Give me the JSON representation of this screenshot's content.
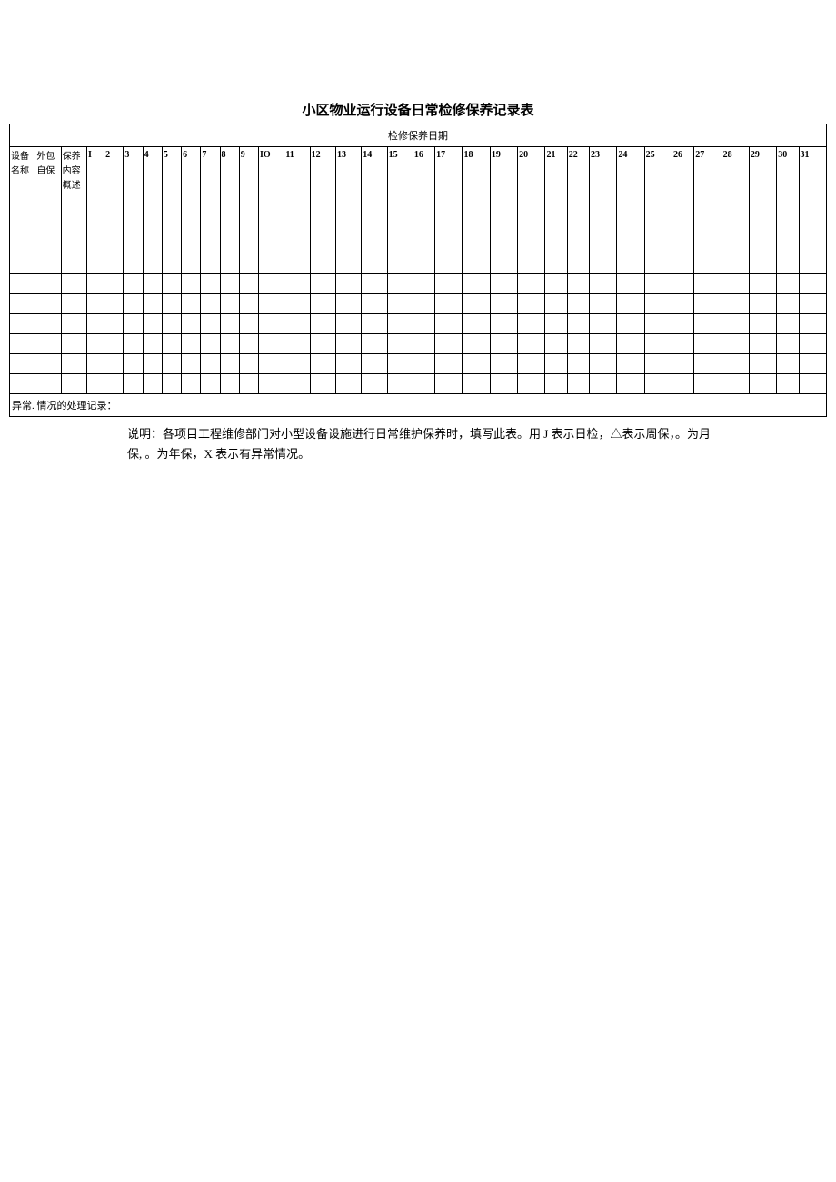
{
  "title": "小区物业运行设备日常检修保养记录表",
  "header_date": "检修保养日期",
  "col_headers": {
    "device_name": "设备名称",
    "outsource_self": "外包自保",
    "maintenance_content": "保养内容概述"
  },
  "days": [
    "I",
    "2",
    "3",
    "4",
    "5",
    "6",
    "7",
    "8",
    "9",
    "IO",
    "11",
    "12",
    "13",
    "14",
    "15",
    "16",
    "17",
    "18",
    "19",
    "20",
    "21",
    "22",
    "23",
    "24",
    "25",
    "26",
    "27",
    "28",
    "29",
    "30",
    "31"
  ],
  "footer_label": "异常. 情况的处理记录：",
  "notes_line1": "说明：各项目工程维修部门对小型设备设施进行日常维护保养时，填写此表。用 J 表示日检，△表示周保，。为月",
  "notes_line2": "保, 。为年保，X 表示有异常情况。"
}
